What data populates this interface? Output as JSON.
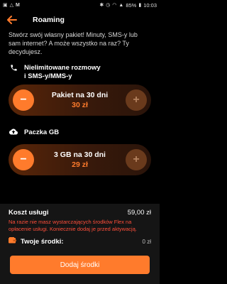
{
  "statusbar": {
    "left_icons": [
      "notification-icon",
      "warning-icon",
      "gmail-icon"
    ],
    "battery": "85%",
    "time": "10:03"
  },
  "appbar": {
    "title": "Roaming"
  },
  "intro": "Stwórz swój własny pakiet! Minuty, SMS-y lub sam internet? A może wszystko na raz? Ty decydujesz.",
  "sections": [
    {
      "icon": "phone-icon",
      "title_line1": "Nielimitowane rozmowy",
      "title_line2": "i SMS-y/MMS-y",
      "package": {
        "name": "Pakiet na 30 dni",
        "price": "30 zł"
      }
    },
    {
      "icon": "cloud-upload-icon",
      "title_line1": "Paczka GB",
      "package": {
        "name": "3 GB na 30 dni",
        "price": "29 zł"
      }
    }
  ],
  "summary": {
    "cost_label": "Koszt usługi",
    "cost_value": "59,00 zł",
    "warning": "Na razie nie masz wystarczających środków Flex na opłacenie usługi. Koniecznie dodaj je przed aktywacją.",
    "funds_label": "Twoje środki:",
    "funds_value": "0 zł",
    "add_button": "Dodaj środki"
  },
  "colors": {
    "accent": "#ff7b2c",
    "warning": "#ff4e3a"
  }
}
